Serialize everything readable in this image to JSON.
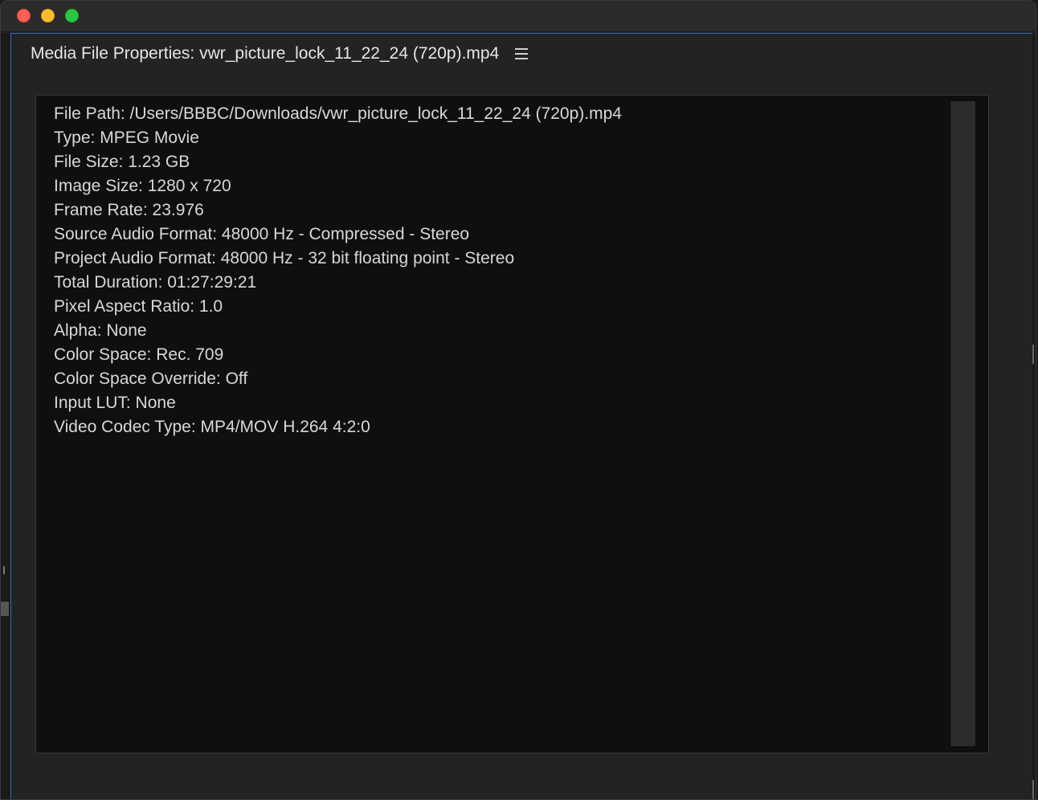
{
  "window": {
    "controls": [
      "close",
      "minimize",
      "zoom"
    ]
  },
  "panel": {
    "title": "Media File Properties: vwr_picture_lock_11_22_24 (720p).mp4",
    "menu_icon": "hamburger-menu-icon",
    "properties": [
      "File Path: /Users/BBBC/Downloads/vwr_picture_lock_11_22_24 (720p).mp4",
      "Type: MPEG Movie",
      "File Size: 1.23 GB",
      "Image Size: 1280 x 720",
      "Frame Rate: 23.976",
      "Source Audio Format: 48000 Hz - Compressed - Stereo",
      "Project Audio Format: 48000 Hz - 32 bit floating point - Stereo",
      "Total Duration: 01:27:29:21",
      "Pixel Aspect Ratio: 1.0",
      "Alpha: None",
      "Color Space: Rec. 709",
      "Color Space Override: Off",
      "Input LUT: None",
      "Video Codec Type: MP4/MOV H.264 4:2:0"
    ]
  },
  "colors": {
    "accent_border": "#2f6fb8",
    "content_bg": "#0f0f0f",
    "panel_bg": "#232323"
  }
}
